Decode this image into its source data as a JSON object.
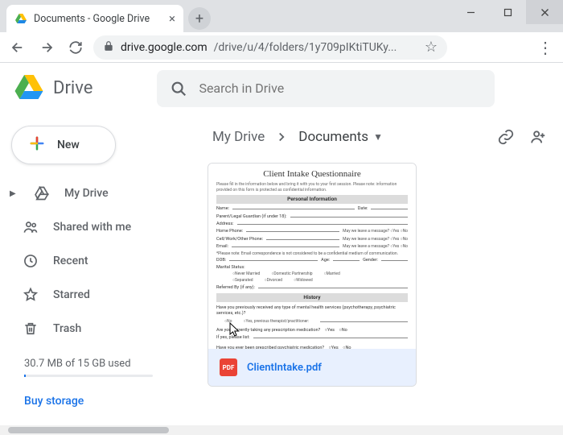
{
  "browser": {
    "tab_title": "Documents - Google Drive",
    "url_host": "drive.google.com",
    "url_path": "/drive/u/4/folders/1y709pIKtiTUKy..."
  },
  "header": {
    "app_name": "Drive",
    "search_placeholder": "Search in Drive"
  },
  "sidebar": {
    "new_label": "New",
    "items": [
      {
        "label": "My Drive"
      },
      {
        "label": "Shared with me"
      },
      {
        "label": "Recent"
      },
      {
        "label": "Starred"
      },
      {
        "label": "Trash"
      }
    ],
    "storage_text": "30.7 MB of 15 GB used",
    "buy_storage": "Buy storage"
  },
  "breadcrumb": {
    "root": "My Drive",
    "current": "Documents"
  },
  "file": {
    "name": "ClientIntake.pdf",
    "badge": "PDF",
    "selected": true,
    "preview": {
      "title": "Client Intake Questionnaire",
      "sections": [
        "Personal Information",
        "History"
      ]
    }
  }
}
